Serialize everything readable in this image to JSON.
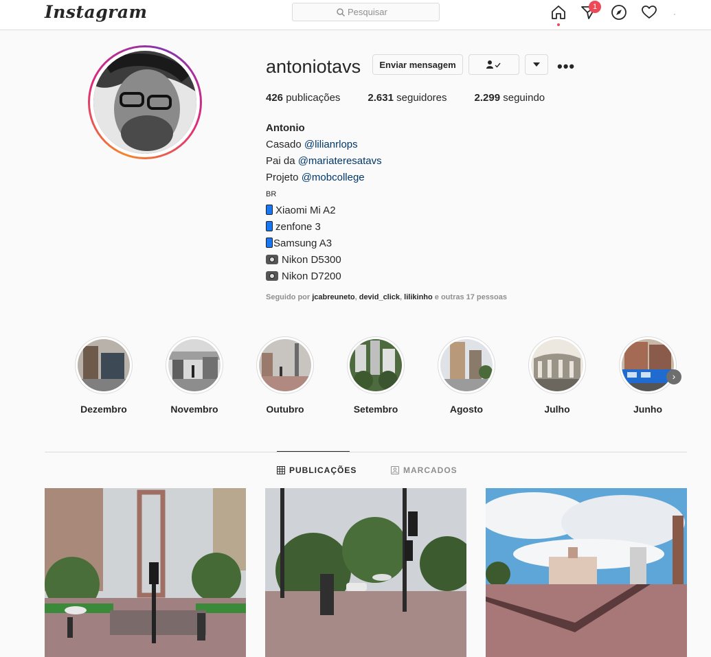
{
  "topnav": {
    "logo": "Instagram",
    "search_placeholder": "Pesquisar",
    "notifications_count": "1",
    "icons": [
      "home-icon",
      "direct-icon",
      "explore-icon",
      "activity-heart-icon"
    ]
  },
  "profile": {
    "username": "antoniotavs",
    "message_button": "Enviar mensagem",
    "stats": [
      {
        "count": "426",
        "label": " publicações"
      },
      {
        "count": "2.631",
        "label": " seguidores"
      },
      {
        "count": "2.299",
        "label": " seguindo"
      }
    ],
    "bio": {
      "name": "Antonio",
      "lines": [
        {
          "prefix": "Casado ",
          "mention": "@lilianrlops"
        },
        {
          "prefix": "Pai da ",
          "mention": "@mariateresatavs"
        },
        {
          "prefix": "Projeto ",
          "mention": "@mobcollege"
        }
      ],
      "country": "BR",
      "devices": [
        "Xiaomi Mi A2",
        "zenfone 3",
        "Samsung A3"
      ],
      "cameras": [
        "Nikon D5300",
        "Nikon D7200"
      ]
    },
    "followed_by": {
      "prefix": "Seguido por ",
      "accounts": [
        "jcabreuneto",
        "devid_click",
        "lilikinho"
      ],
      "suffix": " e outras 17 pessoas"
    }
  },
  "highlights": [
    "Dezembro",
    "Novembro",
    "Outubro",
    "Setembro",
    "Agosto",
    "Julho",
    "Junho"
  ],
  "tabs": {
    "posts": "PUBLICAÇÕES",
    "tagged": "MARCADOS"
  },
  "colors": {
    "accent_link": "#00376b",
    "badge": "#ed4956",
    "text": "#262626",
    "muted": "#8e8e8e"
  }
}
